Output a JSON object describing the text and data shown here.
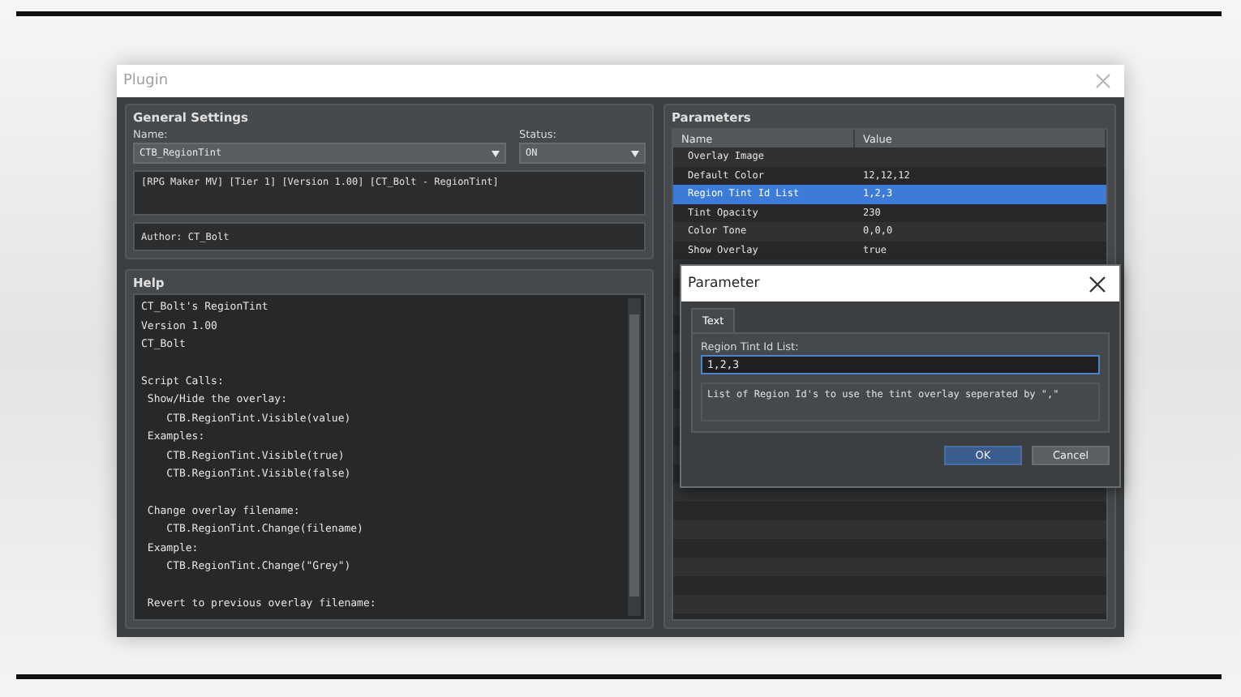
{
  "window": {
    "title": "Plugin"
  },
  "general_settings": {
    "title": "General Settings",
    "name_label": "Name:",
    "name_value": "CTB_RegionTint",
    "status_label": "Status:",
    "status_value": "ON",
    "description": "[RPG Maker MV] [Tier 1] [Version 1.00] [CT_Bolt - RegionTint]",
    "author": "Author: CT_Bolt"
  },
  "help": {
    "title": "Help",
    "blocks": [
      [
        "CT_Bolt's RegionTint",
        "Version 1.00",
        "CT_Bolt"
      ],
      [
        "Script Calls:",
        " Show/Hide the overlay:",
        "    CTB.RegionTint.Visible(value)",
        " Examples:",
        "    CTB.RegionTint.Visible(true)",
        "    CTB.RegionTint.Visible(false)"
      ],
      [
        " Change overlay filename:",
        "    CTB.RegionTint.Change(filename)",
        " Example:",
        "    CTB.RegionTint.Change(\"Grey\")"
      ],
      [
        " Revert to previous overlay filename:"
      ]
    ]
  },
  "parameters": {
    "title": "Parameters",
    "columns": [
      "Name",
      "Value"
    ],
    "rows": [
      {
        "name": "Overlay Image",
        "selected": false
      },
      {
        "name": "Default Color",
        "value": "12,12,12",
        "selected": false
      },
      {
        "name": "Region Tint Id List",
        "value": "1,2,3",
        "selected": true
      },
      {
        "name": "Tint Opacity",
        "value": "230",
        "selected": false
      },
      {
        "name": "Color Tone",
        "value": "0,0,0",
        "selected": false
      },
      {
        "name": "Show Overlay",
        "value": "true",
        "selected": false
      }
    ]
  },
  "dialog": {
    "title": "Parameter",
    "tabs": [
      {
        "label": "Text",
        "selected": true
      }
    ],
    "field_label": "Region Tint Id List:",
    "value": "1,2,3",
    "description": "List of Region Id's to use the tint overlay seperated by \",\"",
    "buttons": [
      {
        "label": "OK",
        "kind": "primary"
      },
      {
        "label": "Cancel",
        "kind": "secondary"
      }
    ]
  }
}
